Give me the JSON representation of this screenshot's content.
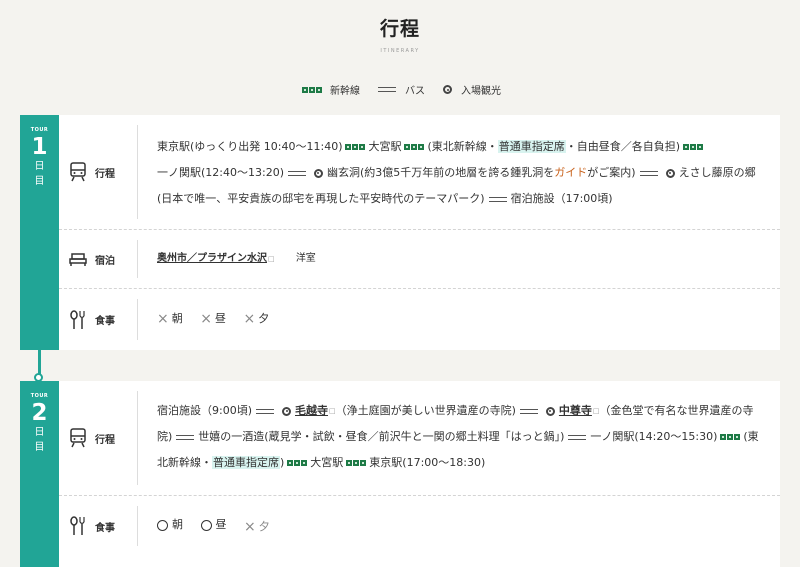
{
  "header": {
    "title": "行程",
    "subtitle": "ITINERARY"
  },
  "legend": {
    "shinkansen": "新幹線",
    "bus": "バス",
    "sightseeing": "入場観光"
  },
  "colors": {
    "accent": "#21a596",
    "shinkansen": "#1e7a46",
    "highlight": "#d8f3ef",
    "guide": "#c9621c"
  },
  "days": [
    {
      "tour": "TOUR",
      "number": "1",
      "char1": "日",
      "char2": "目",
      "itinerary_label": "行程",
      "it": {
        "s1": "東京駅(ゆっくり出発 10:40〜11:40)",
        "s2": "大宮駅",
        "s3a": "(東北新幹線・",
        "s3hl": "普通車指定席",
        "s3b": "・自由昼食／各自負担)",
        "s4": "一ノ関駅(12:40〜13:20)",
        "s5a": "幽玄洞(約3億5千万年前の地層を誇る鍾乳洞を",
        "s5g": "ガイド",
        "s5b": "がご案内)",
        "s6": "えさし藤原の郷(日本で唯一、平安貴族の邸宅を再現した平安時代のテーマパーク)",
        "s7": "宿泊施設（17:00頃)"
      },
      "lodging_label": "宿泊",
      "lodging_name": "奥州市／プラザイン水沢",
      "lodging_room": "洋室",
      "meal_label": "食事",
      "meals": [
        "朝",
        "昼",
        "夕"
      ]
    },
    {
      "tour": "TOUR",
      "number": "2",
      "char1": "日",
      "char2": "目",
      "itinerary_label": "行程",
      "it": {
        "s1": "宿泊施設（9:00頃)",
        "s2": "毛越寺",
        "s3": "（浄土庭園が美しい世界遺産の寺院)",
        "s4": "中尊寺",
        "s5": "（金色堂で有名な世界遺産の寺院)",
        "s6": "世嬉の一酒造(蔵見学・試飲・昼食／前沢牛と一関の郷土料理「はっと鍋」)",
        "s7": "一ノ関駅(14:20〜15:30)",
        "s8a": "(東北新幹線・",
        "s8hl": "普通車指定席",
        "s8b": ")",
        "s9": "大宮駅",
        "s10": "東京駅(17:00〜18:30)"
      },
      "meal_label": "食事",
      "meals": [
        "朝",
        "昼",
        "夕"
      ]
    }
  ]
}
